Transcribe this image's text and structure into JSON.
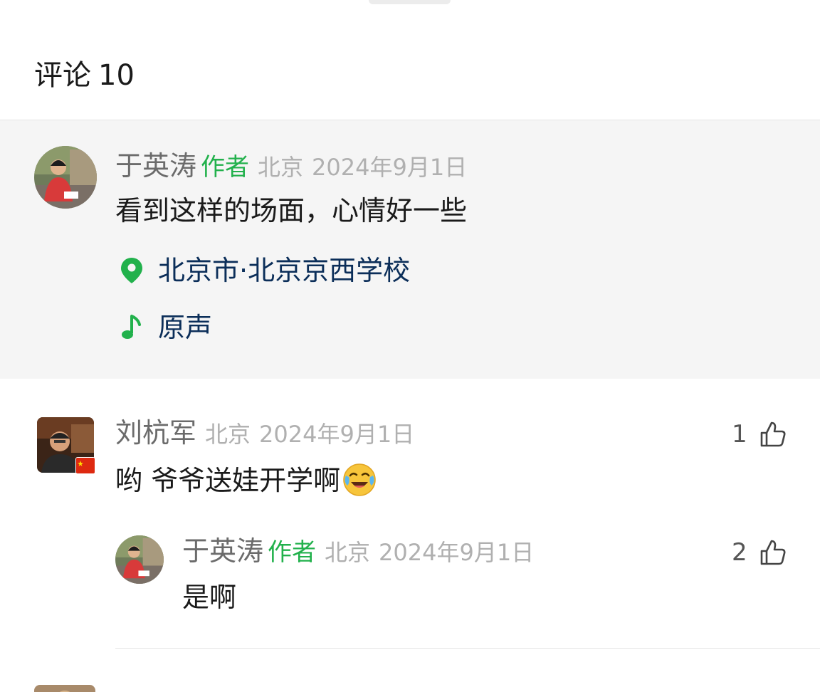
{
  "header": {
    "title": "评论",
    "count": "10"
  },
  "author_comment": {
    "name": "于英涛",
    "badge": "作者",
    "location": "北京",
    "date": "2024年9月1日",
    "text": "看到这样的场面，心情好一些",
    "location_tag": "北京市·北京京西学校",
    "music_tag": "原声",
    "icon_location": "location-pin-icon",
    "icon_music": "music-note-icon",
    "accent_color": "#22b14c"
  },
  "comments": [
    {
      "name": "刘杭军",
      "location": "北京",
      "date": "2024年9月1日",
      "text": "哟 爷爷送娃开学啊",
      "emoji": "laughing-crying-emoji-icon",
      "likes": "1",
      "reply": {
        "name": "于英涛",
        "badge": "作者",
        "location": "北京",
        "date": "2024年9月1日",
        "text": "是啊",
        "likes": "2"
      }
    }
  ]
}
